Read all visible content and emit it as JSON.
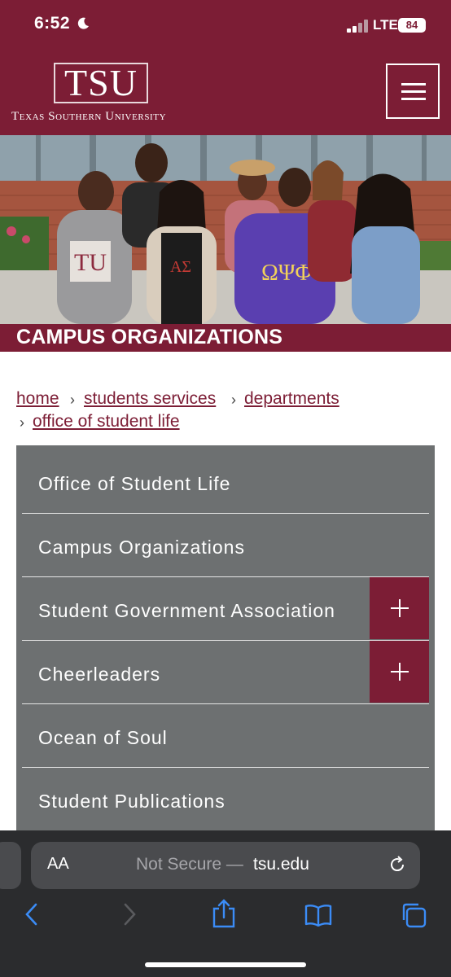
{
  "status_bar": {
    "time": "6:52",
    "network": "LTE",
    "battery": "84"
  },
  "header": {
    "logo": "TSU",
    "university_name": "Texas Southern University",
    "menu_icon": "hamburger-menu-icon"
  },
  "hero": {
    "title": "CAMPUS ORGANIZATIONS"
  },
  "breadcrumb": [
    {
      "label": "home"
    },
    {
      "label": "students services"
    },
    {
      "label": "departments"
    },
    {
      "label": "office of student life"
    }
  ],
  "nav_menu": [
    {
      "label": "Office of Student Life",
      "expandable": false
    },
    {
      "label": "Campus Organizations",
      "expandable": false
    },
    {
      "label": "Student Government Association",
      "expandable": true
    },
    {
      "label": "Cheerleaders",
      "expandable": true
    },
    {
      "label": "Ocean of Soul",
      "expandable": false
    },
    {
      "label": "Student Publications",
      "expandable": false
    }
  ],
  "browser": {
    "aa_label": "AA",
    "security_text": "Not Secure —",
    "domain": "tsu.edu",
    "toolbar_icons": [
      "back-icon",
      "forward-icon",
      "share-icon",
      "bookmarks-icon",
      "tabs-icon"
    ]
  },
  "colors": {
    "brand_maroon": "#7c1d35",
    "menu_gray": "#6d7071",
    "browser_bg": "#2b2c2e"
  }
}
